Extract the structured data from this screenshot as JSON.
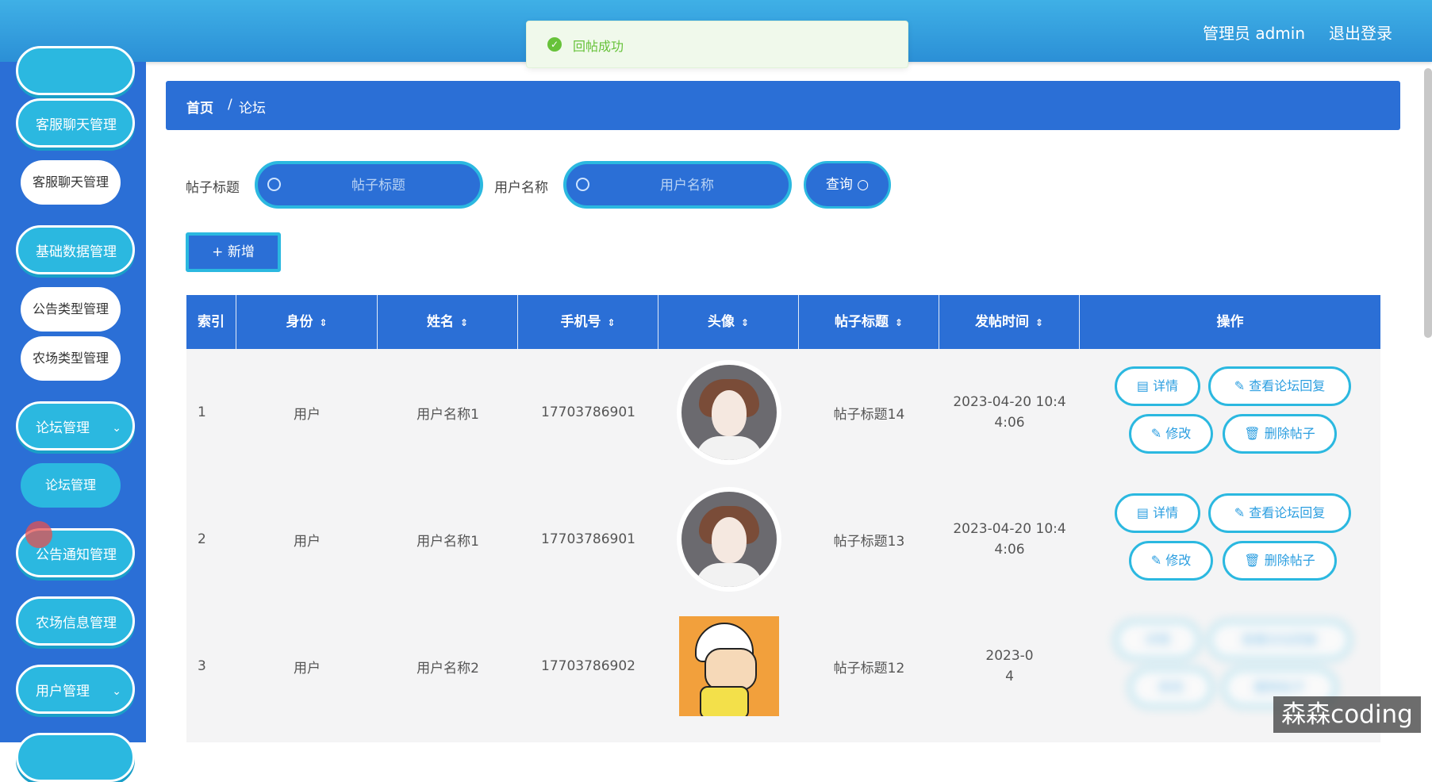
{
  "header": {
    "admin_label": "管理员 admin",
    "logout_label": "退出登录"
  },
  "toast": {
    "message": "回帖成功",
    "icon": "check-circle-icon",
    "color": "#67c23a"
  },
  "sidebar": {
    "items": [
      {
        "label": "客服聊天管理",
        "type": "group"
      },
      {
        "label": "客服聊天管理",
        "type": "sub"
      },
      {
        "label": "基础数据管理",
        "type": "group"
      },
      {
        "label": "公告类型管理",
        "type": "sub"
      },
      {
        "label": "农场类型管理",
        "type": "sub"
      },
      {
        "label": "论坛管理",
        "type": "group",
        "expanded": true
      },
      {
        "label": "论坛管理",
        "type": "sub",
        "active": true
      },
      {
        "label": "公告通知管理",
        "type": "group"
      },
      {
        "label": "农场信息管理",
        "type": "group"
      },
      {
        "label": "用户管理",
        "type": "group"
      }
    ]
  },
  "breadcrumb": {
    "home": "首页",
    "separator": "/",
    "current": "论坛"
  },
  "search": {
    "title_label": "帖子标题",
    "title_placeholder": "帖子标题",
    "user_label": "用户名称",
    "user_placeholder": "用户名称",
    "query_label": "查询"
  },
  "toolbar": {
    "add_label": "+ 新增"
  },
  "table": {
    "columns": [
      "索引",
      "身份",
      "姓名",
      "手机号",
      "头像",
      "帖子标题",
      "发帖时间",
      "操作"
    ],
    "rows": [
      {
        "index": "1",
        "identity": "用户",
        "name": "用户名称1",
        "phone": "17703786901",
        "title": "帖子标题14",
        "time_line1": "2023-04-20 10:4",
        "time_line2": "4:06"
      },
      {
        "index": "2",
        "identity": "用户",
        "name": "用户名称1",
        "phone": "17703786901",
        "title": "帖子标题13",
        "time_line1": "2023-04-20 10:4",
        "time_line2": "4:06"
      },
      {
        "index": "3",
        "identity": "用户",
        "name": "用户名称2",
        "phone": "17703786902",
        "title": "帖子标题12",
        "time_line1": "2023-0",
        "time_line2": "4"
      }
    ],
    "actions": {
      "detail": "详情",
      "view_replies": "查看论坛回复",
      "edit": "修改",
      "delete": "删除帖子"
    }
  },
  "watermark": "森森coding",
  "colors": {
    "primary": "#2b6fd6",
    "accent": "#2bb8e0"
  }
}
